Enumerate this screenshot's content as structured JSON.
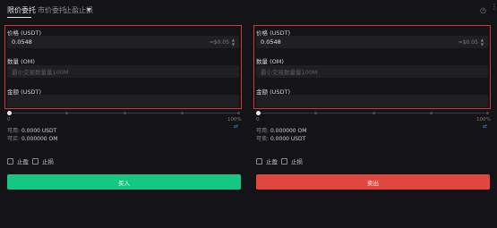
{
  "tabs": [
    {
      "label": "限价委托"
    },
    {
      "label": "市价委托"
    },
    {
      "label": "止盈止损"
    }
  ],
  "buy": {
    "price_label": "价格 (USDT)",
    "price_value": "0.0548",
    "price_suffix": "≈$0.05",
    "qty_label": "数量 (OM)",
    "qty_placeholder": "最小交易数量量100M",
    "amount_label": "金额 (USDT)",
    "slider_min": "0",
    "slider_max": "100%",
    "available_label": "可用:",
    "available_value": "0.0000 USDT",
    "buyable_label": "可买:",
    "buyable_value": "0.000000 OM",
    "take_profit_label": "止盈",
    "stop_loss_label": "止损",
    "submit_label": "买入"
  },
  "sell": {
    "price_label": "价格 (USDT)",
    "price_value": "0.0548",
    "price_suffix": "≈$0.05",
    "qty_label": "数量 (OM)",
    "qty_placeholder": "最小交易数量量100M",
    "amount_label": "金额 (USDT)",
    "slider_min": "0",
    "slider_max": "100%",
    "available_label": "可用:",
    "available_value": "0.000000 OM",
    "sellable_label": "可卖:",
    "sellable_value": "0.0000 USDT",
    "take_profit_label": "止盈",
    "stop_loss_label": "止损",
    "submit_label": "卖出"
  },
  "slider_level": 0,
  "colors": {
    "buy": "#16c784",
    "sell": "#e0473f",
    "highlight": "#d0383a"
  },
  "icons": {
    "dropdown": "chevron-down-icon",
    "clock": "clock-icon",
    "more": "more-icon",
    "swap": "swap-icon"
  }
}
